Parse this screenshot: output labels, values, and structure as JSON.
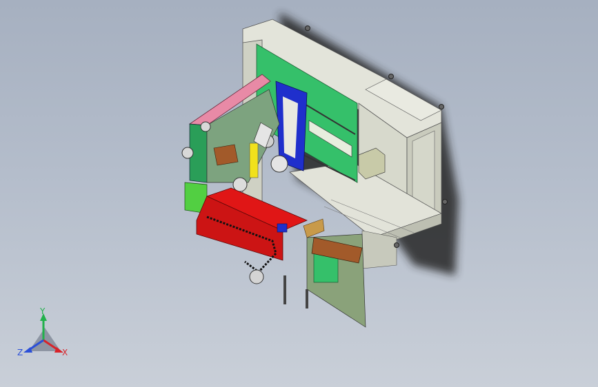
{
  "viewport": {
    "background_top": "#a6b0c0",
    "background_bottom": "#c9cfd8"
  },
  "triad": {
    "x_label": "X",
    "y_label": "Y",
    "z_label": "Z",
    "x_color": "#d8232a",
    "y_color": "#22b14c",
    "z_color": "#2b4fd8"
  },
  "model": {
    "colors": {
      "housing": "#d7d9cc",
      "green_panel": "#35c06a",
      "blue_panel": "#1f2fcc",
      "pink_arm": "#e88aa6",
      "red_block": "#e01616",
      "yellow_part": "#f1e11c",
      "brown_part": "#a25a2a",
      "shadow": "#2a2a2a"
    }
  }
}
